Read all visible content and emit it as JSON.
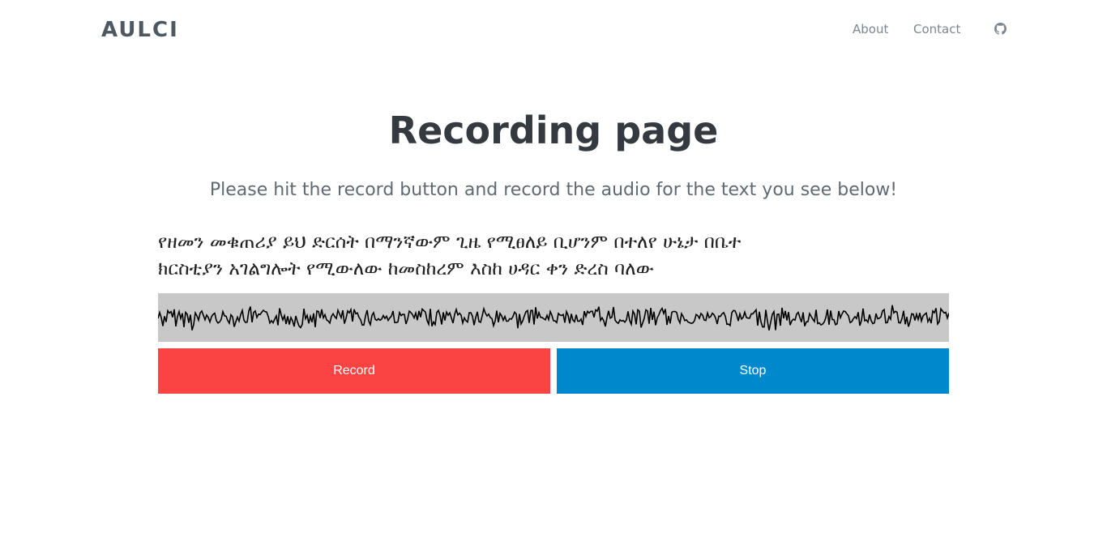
{
  "navbar": {
    "brand": "AULCI",
    "links": [
      {
        "label": "About"
      },
      {
        "label": "Contact"
      }
    ],
    "github_icon": "github-icon"
  },
  "main": {
    "title": "Recording page",
    "subtitle": "Please hit the record button and record the audio for the text you see below!",
    "prompt_lines": [
      "የዘመን መቁጠሪያ ይህ ድርሰት በማንኛውም ጊዜ የሚፀለይ ቢሆንም በተለየ ሁኔታ በቤተ",
      "ክርስቲያን አገልግሎት የሚውለው ከመስከረም እስከ ሀዳር ቀን ድረስ ባለው"
    ]
  },
  "waveform": {
    "background": "#c8c8c8",
    "line_color": "#000000"
  },
  "controls": {
    "record_label": "Record",
    "record_color": "#fa4343",
    "stop_label": "Stop",
    "stop_color": "#0088cc"
  }
}
